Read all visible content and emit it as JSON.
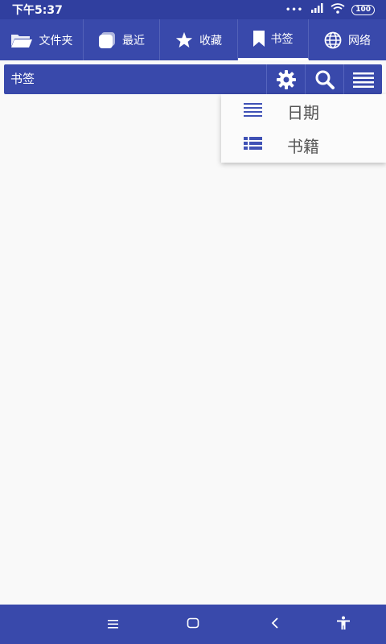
{
  "status": {
    "time": "下午5:37",
    "dots": "•••",
    "battery": "100"
  },
  "tabs": [
    {
      "label": "文件夹",
      "icon": "folder-icon"
    },
    {
      "label": "最近",
      "icon": "recent-icon"
    },
    {
      "label": "收藏",
      "icon": "star-icon"
    },
    {
      "label": "书签",
      "icon": "bookmark-icon",
      "active": true
    },
    {
      "label": "网络",
      "icon": "globe-icon"
    }
  ],
  "toolbar": {
    "title": "书签"
  },
  "menu": {
    "items": [
      {
        "label": "日期",
        "icon": "list-icon"
      },
      {
        "label": "书籍",
        "icon": "detailed-list-icon"
      }
    ]
  },
  "colors": {
    "primary": "#3949ab",
    "status_bar": "#303f9f",
    "background": "#f9f9f9",
    "menu_icon": "#3f51b5"
  }
}
